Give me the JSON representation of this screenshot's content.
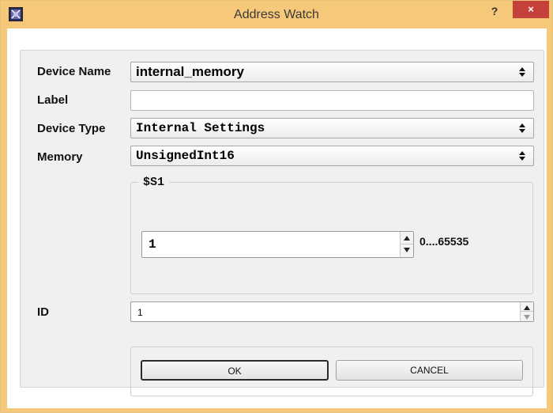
{
  "window": {
    "title": "Address Watch",
    "help_label": "?",
    "close_label": "×"
  },
  "form": {
    "device_name": {
      "label": "Device Name",
      "value": "internal_memory"
    },
    "label_field": {
      "label": "Label",
      "value": ""
    },
    "device_type": {
      "label": "Device Type",
      "value": "Internal Settings"
    },
    "memory": {
      "label": "Memory",
      "value": "UnsignedInt16"
    },
    "group": {
      "title": "$S1",
      "value": "1",
      "range": "0....65535"
    },
    "id": {
      "label": "ID",
      "value": "1"
    }
  },
  "buttons": {
    "ok": "OK",
    "cancel": "CANCEL"
  },
  "colors": {
    "titlebar": "#f6c879",
    "close": "#c7413b",
    "panel": "#f0f0f0"
  },
  "icons": [
    "app-icon",
    "help-icon",
    "close-icon",
    "combo-arrows-icon",
    "spin-up-icon",
    "spin-down-icon"
  ]
}
